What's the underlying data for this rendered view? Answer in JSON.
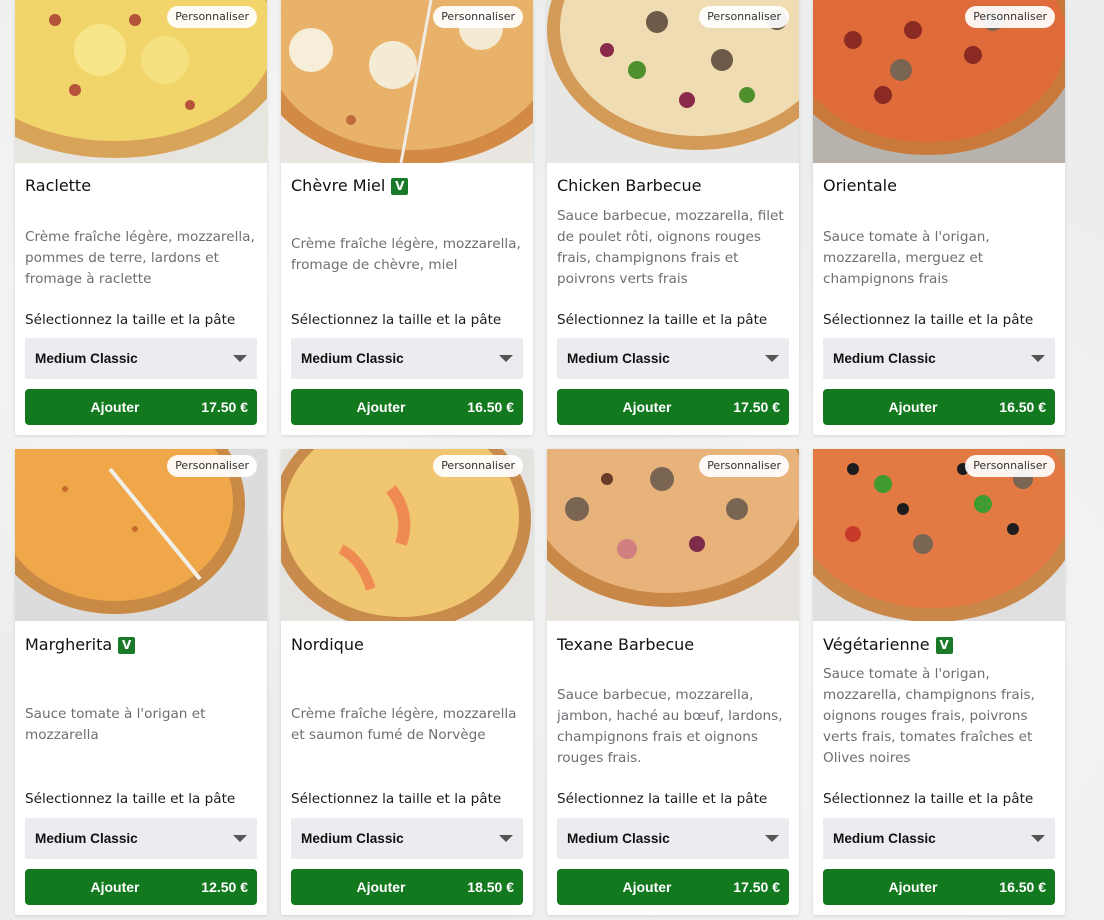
{
  "customize_label": "Personnaliser",
  "select_label": "Sélectionnez la taille et la pâte",
  "add_label": "Ajouter",
  "veg_badge": "V",
  "pizzas": [
    {
      "name": "Raclette",
      "vegetarian": false,
      "description": "Crème fraîche légère, mozzarella, pommes de terre, lardons et fromage à raclette",
      "size": "Medium Classic",
      "price": "17.50 €"
    },
    {
      "name": "Chèvre Miel",
      "vegetarian": true,
      "description": "Crème fraîche légère, mozzarella, fromage de chèvre, miel",
      "size": "Medium Classic",
      "price": "16.50 €"
    },
    {
      "name": "Chicken Barbecue",
      "vegetarian": false,
      "description": "Sauce barbecue, mozzarella, filet de poulet rôti, oignons rouges frais, champignons frais et poivrons verts frais",
      "size": "Medium Classic",
      "price": "17.50 €"
    },
    {
      "name": "Orientale",
      "vegetarian": false,
      "description": "Sauce tomate à l'origan, mozzarella, merguez et champignons frais",
      "size": "Medium Classic",
      "price": "16.50 €"
    },
    {
      "name": "Margherita",
      "vegetarian": true,
      "description": "Sauce tomate à l'origan et mozzarella",
      "size": "Medium Classic",
      "price": "12.50 €"
    },
    {
      "name": "Nordique",
      "vegetarian": false,
      "description": "Crème fraîche légère, mozzarella et saumon fumé de Norvège",
      "size": "Medium Classic",
      "price": "18.50 €"
    },
    {
      "name": "Texane Barbecue",
      "vegetarian": false,
      "description": "Sauce barbecue, mozzarella, jambon, haché au bœuf, lardons, champignons frais et oignons rouges frais.",
      "size": "Medium Classic",
      "price": "17.50 €"
    },
    {
      "name": "Végétarienne",
      "vegetarian": true,
      "description": "Sauce tomate à l'origan, mozzarella, champignons frais, oignons rouges frais, poivrons verts frais, tomates fraîches et Olives noires",
      "size": "Medium Classic",
      "price": "16.50 €"
    }
  ],
  "colors": {
    "button": "#12791f",
    "badge": "#1a7a2a",
    "select_bg": "#ebecef"
  }
}
